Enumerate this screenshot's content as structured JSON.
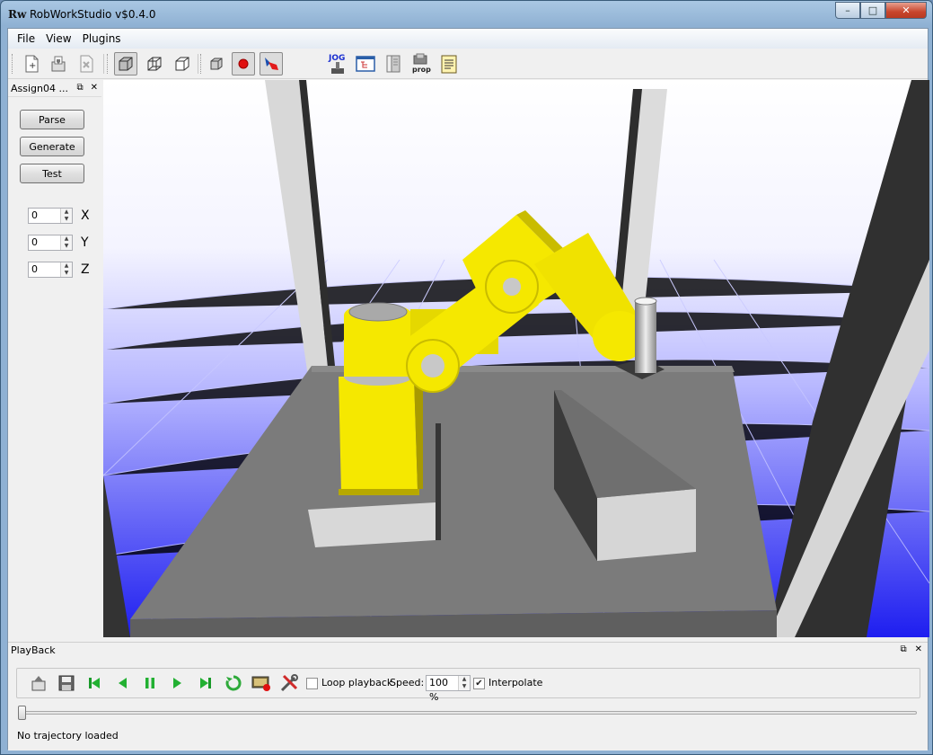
{
  "window": {
    "title": "RobWorkStudio v$0.4.0",
    "logo": "Rw",
    "minimize": "–",
    "maximize": "□",
    "close": "✕"
  },
  "menubar": [
    "File",
    "View",
    "Plugins"
  ],
  "toolbar": {
    "icons": [
      "new-icon",
      "open-icon",
      "close-file-icon",
      "solid-view-icon",
      "wireframe-view-icon",
      "outline-view-icon",
      "cube-icon",
      "record-icon",
      "paint-icon",
      "jog-plugin-icon",
      "tree-view-icon",
      "log-icon",
      "prop-plugin-icon",
      "notes-icon"
    ],
    "jog_label": "JOG",
    "prop_label": "prop"
  },
  "plugin_dock": {
    "title": "Assign04 ...",
    "float_icon": "⧉",
    "close_icon": "✕",
    "buttons": [
      "Parse",
      "Generate",
      "Test"
    ],
    "spinboxes": [
      {
        "value": "0",
        "label": "X"
      },
      {
        "value": "0",
        "label": "Y"
      },
      {
        "value": "0",
        "label": "Z"
      }
    ]
  },
  "playback": {
    "title": "PlayBack",
    "loop_label": "Loop playback",
    "loop_checked": false,
    "speed_label": "Speed:",
    "speed_value": "100 %",
    "interpolate_label": "Interpolate",
    "interpolate_checked": true,
    "check_mark": "✔",
    "slider_value": 0,
    "status": "No trajectory loaded"
  },
  "colors": {
    "robot": "#f2e600",
    "sky_top": "#ffffff",
    "sky_bottom": "#2222ee",
    "table": "#7a7a7a"
  }
}
